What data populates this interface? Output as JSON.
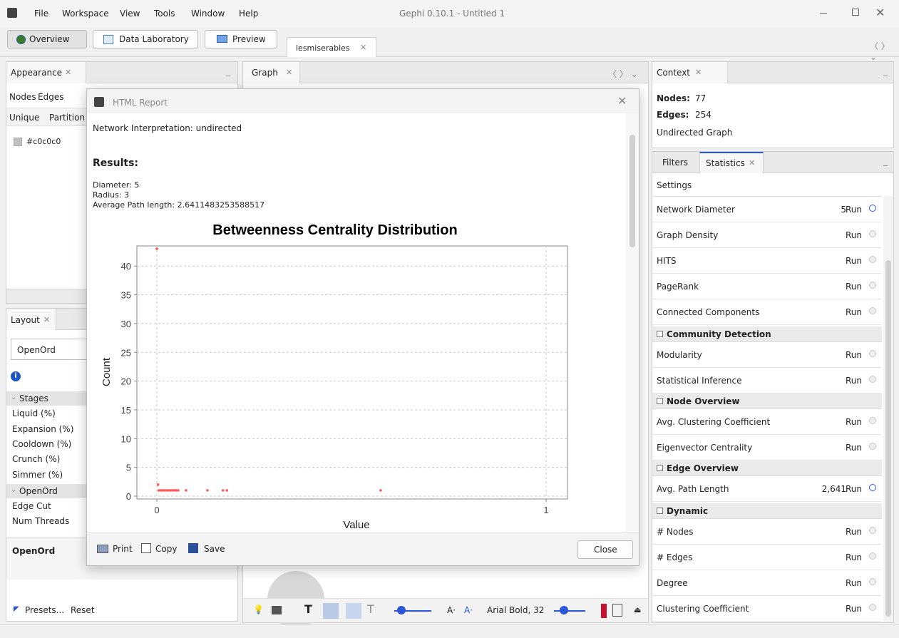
{
  "window": {
    "title": "Gephi 0.10.1 - Untitled 1"
  },
  "menu": [
    "File",
    "Workspace",
    "View",
    "Tools",
    "Window",
    "Help"
  ],
  "toolbar": {
    "overview": "Overview",
    "data_lab": "Data Laboratory",
    "preview": "Preview",
    "workspace_tab": "lesmiserables"
  },
  "appearance": {
    "tab": "Appearance",
    "nodes": "Nodes",
    "edges": "Edges",
    "unique": "Unique",
    "partition": "Partition",
    "color_value": "#c0c0c0"
  },
  "layout": {
    "tab": "Layout",
    "algorithm": "OpenOrd",
    "stages_header": "Stages",
    "stages": [
      "Liquid (%)",
      "Expansion (%)",
      "Cooldown (%)",
      "Crunch (%)",
      "Simmer (%)"
    ],
    "openord_header": "OpenOrd",
    "props": [
      "Edge Cut",
      "Num Threads"
    ],
    "desc_title": "OpenOrd",
    "presets": "Presets...",
    "reset": "Reset"
  },
  "graph": {
    "tab": "Graph",
    "font_label": "Arial Bold, 32"
  },
  "context": {
    "tab": "Context",
    "nodes_label": "Nodes:",
    "nodes_value": "77",
    "edges_label": "Edges:",
    "edges_value": "254",
    "graph_type": "Undirected Graph"
  },
  "stats": {
    "filters_tab": "Filters",
    "statistics_tab": "Statistics",
    "settings": "Settings",
    "run": "Run",
    "items_a": [
      {
        "label": "Network Diameter",
        "value": "5"
      },
      {
        "label": "Graph Density",
        "value": ""
      },
      {
        "label": "HITS",
        "value": ""
      },
      {
        "label": "PageRank",
        "value": ""
      },
      {
        "label": "Connected Components",
        "value": ""
      }
    ],
    "sec_community": "Community Detection",
    "items_b": [
      {
        "label": "Modularity"
      },
      {
        "label": "Statistical Inference"
      }
    ],
    "sec_node": "Node Overview",
    "items_c": [
      {
        "label": "Avg. Clustering Coefficient"
      },
      {
        "label": "Eigenvector Centrality"
      }
    ],
    "sec_edge": "Edge Overview",
    "items_d": [
      {
        "label": "Avg. Path Length",
        "value": "2,641"
      }
    ],
    "sec_dynamic": "Dynamic",
    "items_e": [
      {
        "label": "# Nodes"
      },
      {
        "label": "# Edges"
      },
      {
        "label": "Degree"
      },
      {
        "label": "Clustering Coefficient"
      }
    ]
  },
  "dialog": {
    "title": "HTML Report",
    "interpretation": "Network Interpretation: undirected",
    "results": "Results:",
    "diameter": "Diameter: 5",
    "radius": "Radius: 3",
    "avg_path": "Average Path length: 2.6411483253588517",
    "print": "Print",
    "copy": "Copy",
    "save": "Save",
    "close": "Close"
  },
  "chart_data": {
    "type": "scatter",
    "title": "Betweenness Centrality Distribution",
    "xlabel": "Value",
    "ylabel": "Count",
    "xlim": [
      0,
      1
    ],
    "ylim": [
      0,
      43
    ],
    "x_ticks": [
      "0",
      "1"
    ],
    "y_ticks": [
      "0",
      "5",
      "10",
      "15",
      "20",
      "25",
      "30",
      "35",
      "40"
    ],
    "grid": true,
    "points": [
      {
        "x": 0.0,
        "y": 43
      },
      {
        "x": 0.003,
        "y": 2
      },
      {
        "x": 0.005,
        "y": 1
      },
      {
        "x": 0.01,
        "y": 1
      },
      {
        "x": 0.015,
        "y": 1
      },
      {
        "x": 0.02,
        "y": 1
      },
      {
        "x": 0.025,
        "y": 1
      },
      {
        "x": 0.03,
        "y": 1
      },
      {
        "x": 0.035,
        "y": 1
      },
      {
        "x": 0.04,
        "y": 1
      },
      {
        "x": 0.045,
        "y": 1
      },
      {
        "x": 0.05,
        "y": 1
      },
      {
        "x": 0.055,
        "y": 1
      },
      {
        "x": 0.075,
        "y": 1
      },
      {
        "x": 0.13,
        "y": 1
      },
      {
        "x": 0.17,
        "y": 1
      },
      {
        "x": 0.18,
        "y": 1
      },
      {
        "x": 0.575,
        "y": 1
      }
    ],
    "point_color": "#ff5a5a"
  }
}
